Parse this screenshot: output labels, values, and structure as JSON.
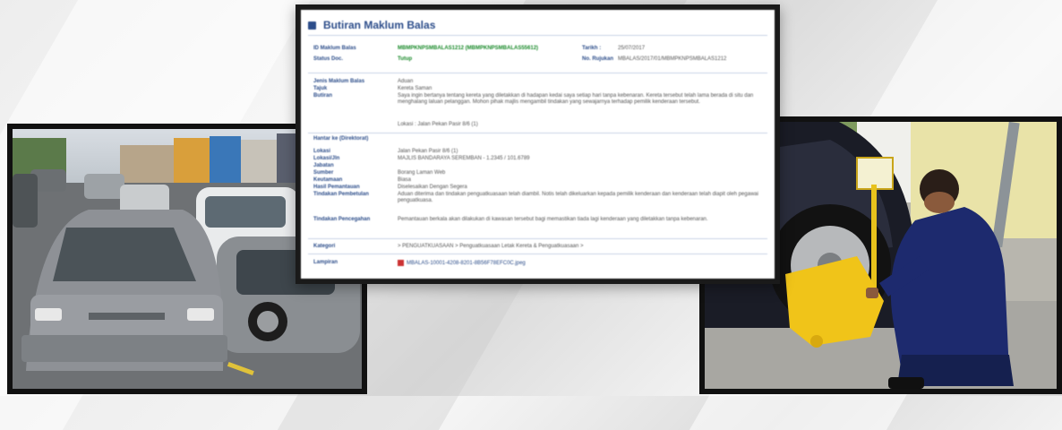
{
  "document": {
    "title": "Butiran Maklum Balas",
    "rows": [
      {
        "label": "ID Maklum Balas",
        "value": "MBMPKNPSMBALAS1212 (MBMPKNPSMBALAS55612)",
        "right_label": "Tarikh :",
        "right_value": "25/07/2017"
      },
      {
        "label": "Status Doc.",
        "value": "Tutup",
        "right_label": "No. Rujukan",
        "right_value": "MBALAS/2017/01/MBMPKNPSMBALAS1212"
      },
      {
        "label": "Jenis Maklum Balas",
        "value": "Aduan"
      },
      {
        "label": "Tajuk",
        "value": "Kereta Saman"
      },
      {
        "label": "Butiran",
        "value": "Saya ingin bertanya tentang kereta yang diletakkan di hadapan kedai saya setiap hari tanpa kebenaran. Kereta tersebut telah lama berada di situ dan menghalang laluan pelanggan. Mohon pihak majlis mengambil tindakan yang sewajarnya terhadap pemilik kenderaan tersebut."
      },
      {
        "label": "",
        "value": "Lokasi : Jalan Pekan Pasir 8/6 (1)"
      },
      {
        "label": "Hantar ke (Direktorat)",
        "value": ""
      },
      {
        "label": "Lokasi",
        "value": "Jalan Pekan Pasir 8/6 (1)"
      },
      {
        "label": "Lokasi/Jln",
        "value": "MAJLIS BANDARAYA SEREMBAN - 1.2345 / 101.6789"
      },
      {
        "label": "Jabatan",
        "value": ""
      },
      {
        "label": "Sumber",
        "value": "Borang Laman Web"
      },
      {
        "label": "Keutamaan",
        "value": "Biasa"
      },
      {
        "label": "Hasil Pemantauan",
        "value": "Diselesaikan Dengan Segera"
      },
      {
        "label": "Tindakan Pembetulan",
        "value": "Aduan diterima dan tindakan penguatkuasaan telah diambil. Notis telah dikeluarkan kepada pemilik kenderaan dan kenderaan telah diapit oleh pegawai penguatkuasa."
      },
      {
        "label": "Tindakan Pencegahan",
        "value": "Pemantauan berkala akan dilakukan di kawasan tersebut bagi memastikan tiada lagi kenderaan yang diletakkan tanpa kebenaran."
      },
      {
        "label": "Kategori",
        "value": "> PENGUATKUASAAN > Penguatkuasaan Letak Kereta & Penguatkuasaan >"
      },
      {
        "label": "Lampiran",
        "value": "MBALAS-10001-4208-8201-8B56F78EFC0C.jpeg"
      }
    ]
  }
}
